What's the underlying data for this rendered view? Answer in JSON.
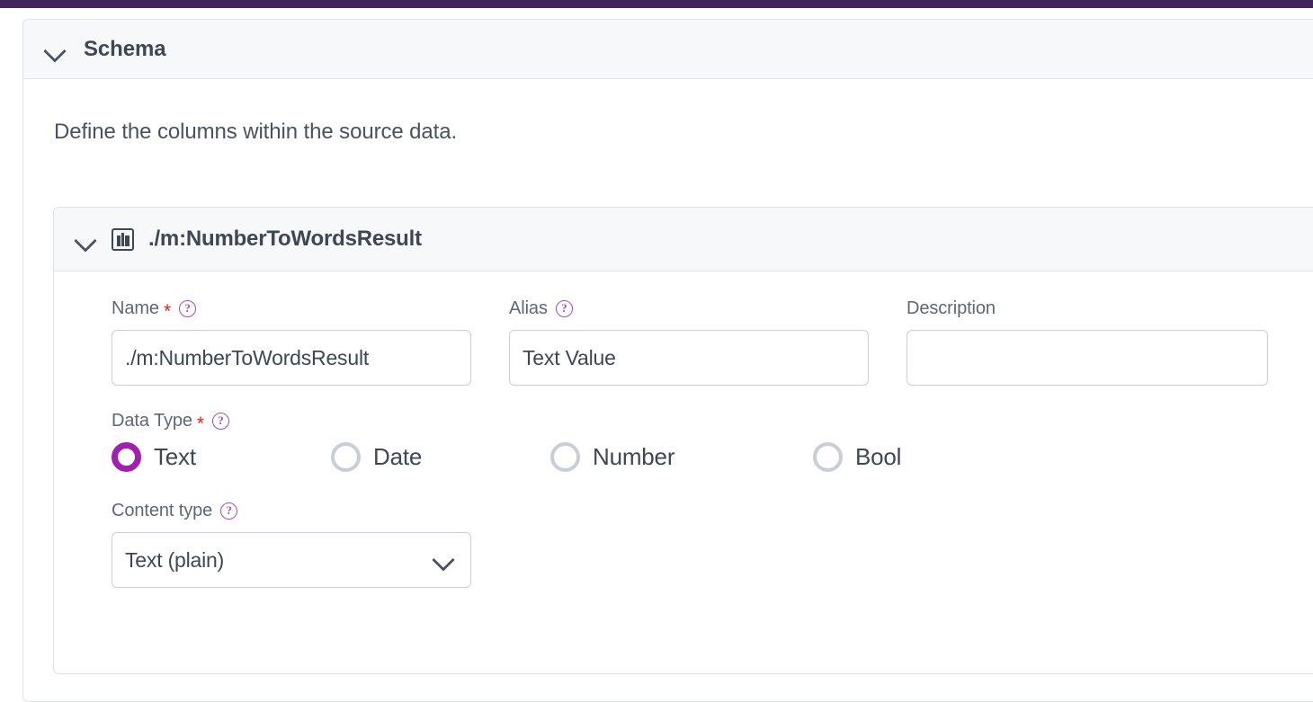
{
  "topbar": {
    "color": "#41265c"
  },
  "schema_section": {
    "title": "Schema",
    "collapse_icon": "chevron-down-icon",
    "description": "Define the columns within the source data."
  },
  "column_panel": {
    "collapse_icon": "chevron-down-icon",
    "type_icon": "columns-icon",
    "name": "./m:NumberToWordsResult",
    "fields": {
      "name": {
        "label": "Name",
        "required_marker": "*",
        "help_icon": "help-circle-icon",
        "value": "./m:NumberToWordsResult",
        "placeholder": ""
      },
      "alias": {
        "label": "Alias",
        "help_icon": "help-circle-icon",
        "value": "Text Value",
        "placeholder": ""
      },
      "description": {
        "label": "Description",
        "value": "",
        "placeholder": ""
      },
      "data_type": {
        "label": "Data Type",
        "required_marker": "*",
        "help_icon": "help-circle-icon",
        "selected": "Text",
        "options": [
          {
            "label": "Text",
            "checked": true
          },
          {
            "label": "Date",
            "checked": false
          },
          {
            "label": "Number",
            "checked": false
          },
          {
            "label": "Bool",
            "checked": false
          }
        ]
      },
      "content_type": {
        "label": "Content type",
        "help_icon": "help-circle-icon",
        "selected": "Text (plain)",
        "dropdown_icon": "chevron-down-icon",
        "options": [
          "Text (plain)"
        ]
      }
    }
  },
  "colors": {
    "accent_purple": "#a020b0",
    "help_purple": "#9b4dca",
    "topbar_purple": "#41265c",
    "required_red": "#e02020",
    "text_dark": "#3e4754",
    "border_gray": "#c9ced8",
    "header_bg": "#f7f8fa"
  }
}
